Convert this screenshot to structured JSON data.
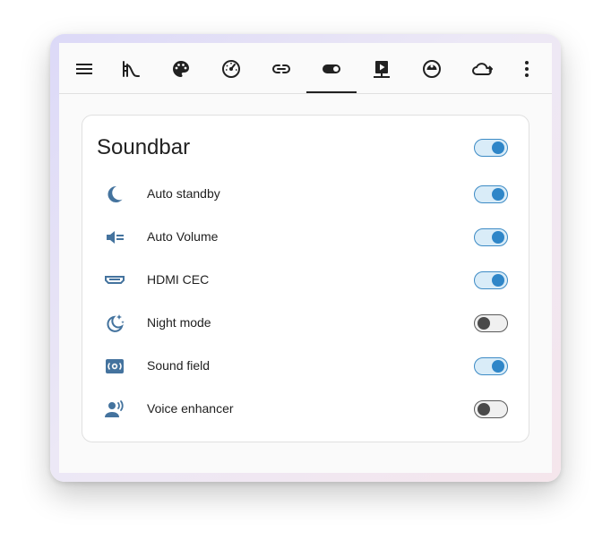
{
  "toolbar": {
    "tabs": [
      {
        "icon": "stairs-icon",
        "active": false
      },
      {
        "icon": "palette-icon",
        "active": false
      },
      {
        "icon": "speedometer-icon",
        "active": false
      },
      {
        "icon": "link-icon",
        "active": false
      },
      {
        "icon": "toggle-switch-icon",
        "active": true
      },
      {
        "icon": "play-box-icon",
        "active": false
      },
      {
        "icon": "robot-vacuum-icon",
        "active": false
      },
      {
        "icon": "cloud-arrow-icon",
        "active": false
      }
    ]
  },
  "card": {
    "title": "Soundbar",
    "master_on": true,
    "rows": [
      {
        "label": "Auto standby",
        "icon": "moon-icon",
        "on": true
      },
      {
        "label": "Auto Volume",
        "icon": "volume-equal-icon",
        "on": true
      },
      {
        "label": "HDMI CEC",
        "icon": "hdmi-port-icon",
        "on": true
      },
      {
        "label": "Night mode",
        "icon": "moon-star-icon",
        "on": false
      },
      {
        "label": "Sound field",
        "icon": "speaker-field-icon",
        "on": true
      },
      {
        "label": "Voice enhancer",
        "icon": "account-voice-icon",
        "on": false
      }
    ]
  },
  "colors": {
    "accent": "#2f86c8",
    "icon": "#44739e",
    "text": "#212121"
  }
}
